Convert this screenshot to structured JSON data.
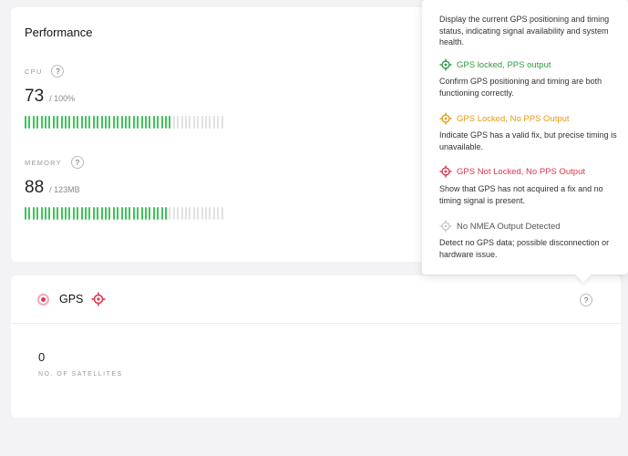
{
  "performance": {
    "title": "Performance",
    "cpu": {
      "label": "CPU",
      "value": "73",
      "max": "/ 100%",
      "fraction": 0.73
    },
    "memory": {
      "label": "MEMORY",
      "value": "88",
      "max": "/ 123MB",
      "fraction": 0.72
    },
    "help_label": "?"
  },
  "gps": {
    "title": "GPS",
    "help_label": "?",
    "satellites_value": "0",
    "satellites_label": "NO. OF SATELLITES"
  },
  "tooltip": {
    "intro": "Display the current GPS positioning and timing status, indicating signal availability and system health.",
    "items": [
      {
        "label": "GPS locked, PPS output",
        "color": "#2e9a3e",
        "icon": "crosshair-icon",
        "desc": "Confirm GPS positioning and timing are both functioning correctly."
      },
      {
        "label": "GPS Locked, No PPS Output",
        "color": "#e49a17",
        "icon": "crosshair-icon",
        "desc": "Indicate GPS has a valid fix, but precise timing is unavailable."
      },
      {
        "label": "GPS Not Locked, No PPS Output",
        "color": "#d9364e",
        "icon": "crosshair-icon",
        "desc": "Show that GPS has not acquired a fix and no timing signal is present."
      },
      {
        "label": "No NMEA Output Detected",
        "color": "#c9c9c9",
        "icon": "crosshair-icon",
        "desc": "Detect no GPS data; possible disconnection or hardware issue."
      }
    ]
  },
  "colors": {
    "bar_active": "#3ec45a",
    "bar_inactive": "#e2e2e2",
    "status_red": "#e0364f"
  }
}
